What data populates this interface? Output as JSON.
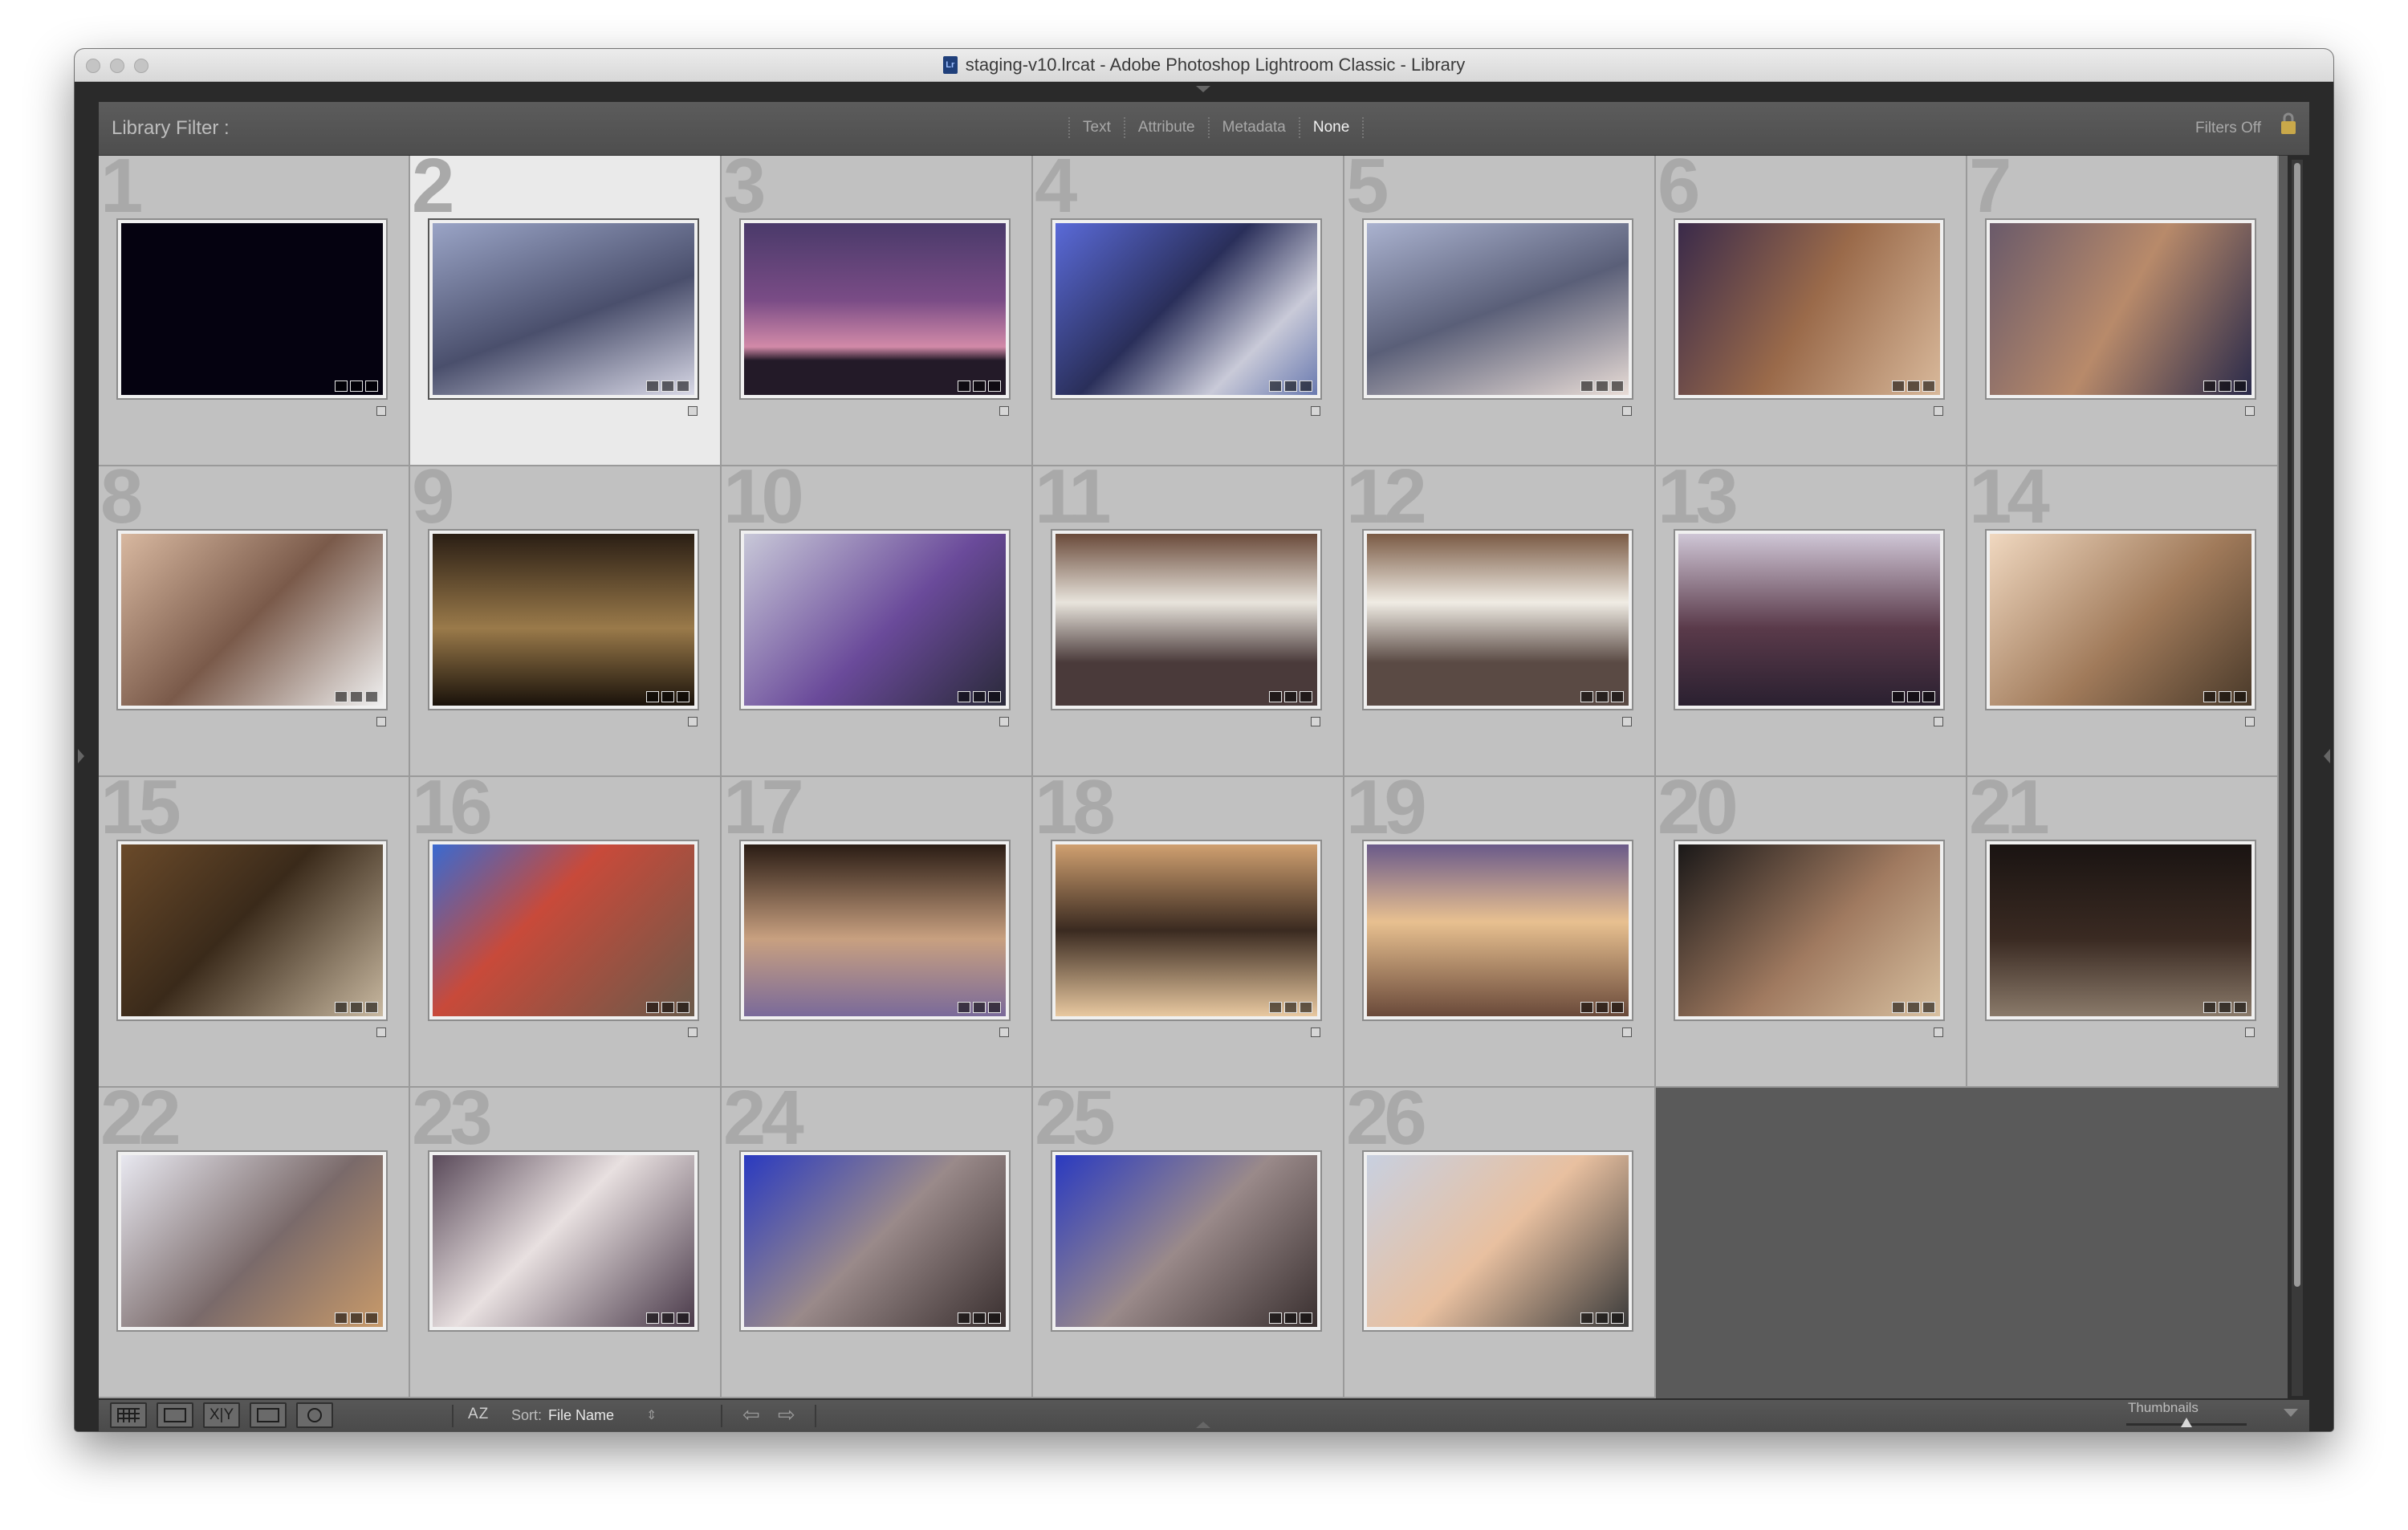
{
  "window": {
    "title": "staging-v10.lrcat - Adobe Photoshop Lightroom Classic - Library",
    "app_icon": "lightroom-catalog-icon"
  },
  "filter_bar": {
    "label": "Library Filter :",
    "tabs": [
      "Text",
      "Attribute",
      "Metadata",
      "None"
    ],
    "active_tab": "None",
    "filters_state": "Filters Off",
    "lock_icon": "lock-icon"
  },
  "grid": {
    "selected": 2,
    "cells": [
      {
        "num": "1",
        "scene": "black frame"
      },
      {
        "num": "2",
        "scene": "car selfie"
      },
      {
        "num": "3",
        "scene": "purple sunset"
      },
      {
        "num": "4",
        "scene": "store aisle, rotated"
      },
      {
        "num": "5",
        "scene": "family in car"
      },
      {
        "num": "6",
        "scene": "bakery display, rotated"
      },
      {
        "num": "7",
        "scene": "fridge aisle, rotated"
      },
      {
        "num": "8",
        "scene": "selfie with boy"
      },
      {
        "num": "9",
        "scene": "drinks coolers"
      },
      {
        "num": "10",
        "scene": "boy at coolers"
      },
      {
        "num": "11",
        "scene": "school hall"
      },
      {
        "num": "12",
        "scene": "school hall"
      },
      {
        "num": "13",
        "scene": "store ceiling, rotated"
      },
      {
        "num": "14",
        "scene": "boy in aisle"
      },
      {
        "num": "15",
        "scene": "store aisle, rotated"
      },
      {
        "num": "16",
        "scene": "boy by soda display"
      },
      {
        "num": "17",
        "scene": "kitchen table, rotated"
      },
      {
        "num": "18",
        "scene": "dinner, rotated"
      },
      {
        "num": "19",
        "scene": "dining room"
      },
      {
        "num": "20",
        "scene": "man with printer"
      },
      {
        "num": "21",
        "scene": "dark hallway, rotated"
      },
      {
        "num": "22",
        "scene": "living room"
      },
      {
        "num": "23",
        "scene": "girl in living room"
      },
      {
        "num": "24",
        "scene": "boy on couch, rotated"
      },
      {
        "num": "25",
        "scene": "boy on couch, rotated"
      },
      {
        "num": "26",
        "scene": "boy and man selfie"
      }
    ]
  },
  "toolbar": {
    "view_buttons": [
      {
        "name": "grid-view-button",
        "icon": "grid-icon"
      },
      {
        "name": "loupe-view-button",
        "icon": "loupe-icon"
      },
      {
        "name": "compare-view-button",
        "icon": "compare-icon",
        "text": "X|Y"
      },
      {
        "name": "survey-view-button",
        "icon": "survey-icon"
      },
      {
        "name": "people-view-button",
        "icon": "face-icon"
      }
    ],
    "sort_icon": "AZ",
    "sort_label": "Sort:",
    "sort_value": "File Name",
    "sort_caret": "⇕",
    "prev_arrow": "⇦",
    "next_arrow": "⇨",
    "thumbnails_label": "Thumbnails",
    "thumbnail_size": 0.5
  }
}
